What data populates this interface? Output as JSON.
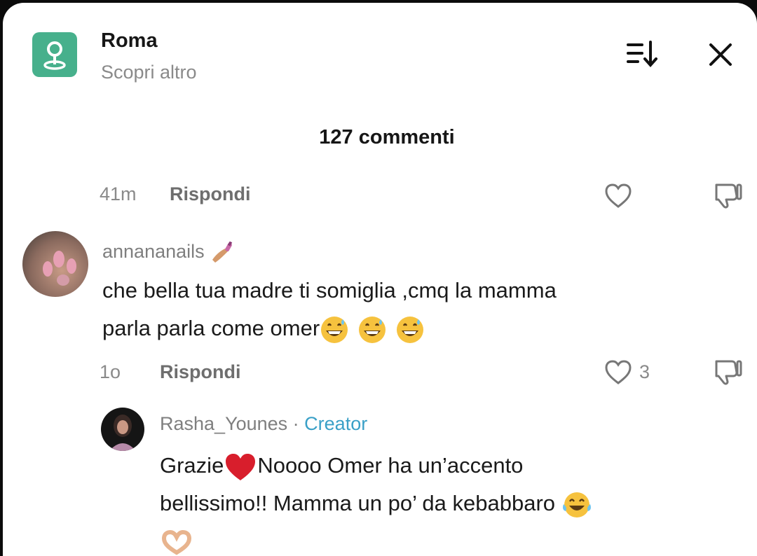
{
  "header": {
    "location_title": "Roma",
    "location_subtitle": "Scopri altro"
  },
  "comments_count_label": "127 commenti",
  "top_row": {
    "time": "41m",
    "reply_label": "Rispondi"
  },
  "comment": {
    "username": "annananails",
    "text_line1": "che bella tua madre ti somiglia ,cmq la mamma",
    "text_line2": "parla parla come omer",
    "time": "1o",
    "reply_label": "Rispondi",
    "likes": "3"
  },
  "reply": {
    "username": "Rasha_Younes",
    "separator": " · ",
    "badge": "Creator",
    "text_line1a": "Grazie",
    "text_line1b": "Noooo Omer ha un’accento",
    "text_line2": "bellissimo!! Mamma un po’ da kebabbaro"
  },
  "icons": {
    "location": "location-pin-icon",
    "sort": "sort-icon",
    "close": "close-icon",
    "like": "heart-outline-icon",
    "dislike": "thumbs-down-icon",
    "nail_emoji": "nail-polish-emoji",
    "sweat_smile": "grinning-sweat-emoji",
    "heart": "red-heart-emoji",
    "tears_of_joy": "tears-of-joy-emoji",
    "heart_hands": "heart-hands-emoji"
  },
  "colors": {
    "location_badge": "#47b08c",
    "creator_badge": "#3aa0c7"
  }
}
